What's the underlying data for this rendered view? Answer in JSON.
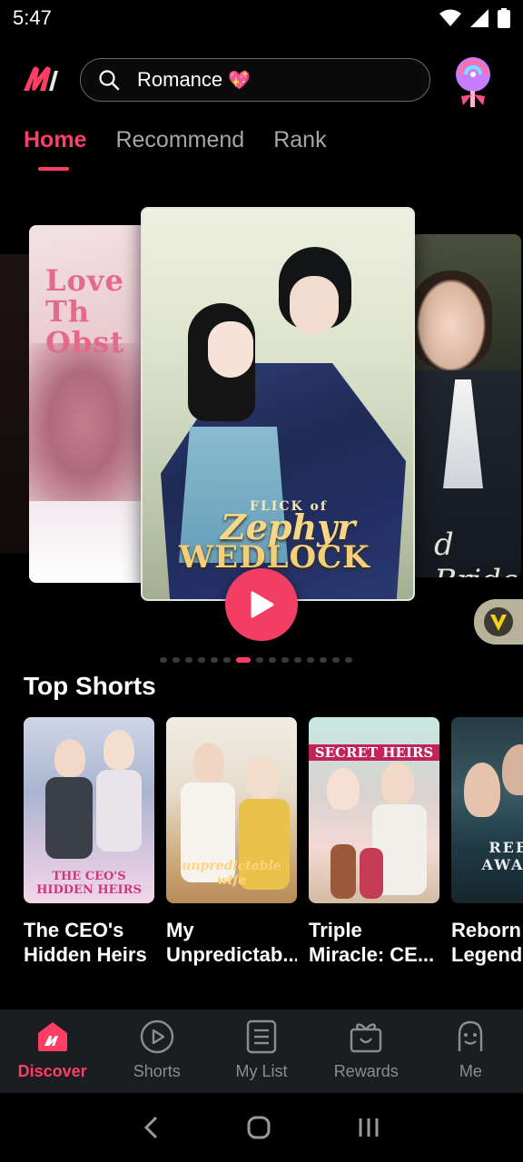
{
  "status": {
    "time": "5:47"
  },
  "search": {
    "text": "Romance",
    "emoji": "💖"
  },
  "tabs": [
    {
      "label": "Home",
      "active": true
    },
    {
      "label": "Recommend",
      "active": false
    },
    {
      "label": "Rank",
      "active": false
    }
  ],
  "carousel": {
    "left_title": "Love Th Obst",
    "main_title_small": "FLICK of",
    "main_title_1": "Zephyr",
    "main_title_2": "WEDLOCK",
    "right_title": "d Bride",
    "dots_total": 15,
    "dots_active_index": 6
  },
  "top_shorts": {
    "title": "Top Shorts",
    "items": [
      {
        "title": "The CEO's Hidden Heirs",
        "poster_text": "THE CEO'S HIDDEN HEIRS"
      },
      {
        "title": "My Unpredictab...",
        "poster_text": "unpredictable wife"
      },
      {
        "title": "Triple Miracle: CE...",
        "poster_text": "SECRET HEIRS"
      },
      {
        "title": "Reborn: Legend",
        "poster_text": "REBO AWAKE"
      }
    ]
  },
  "bottom_nav": [
    {
      "label": "Discover",
      "icon": "discover-icon",
      "active": true
    },
    {
      "label": "Shorts",
      "icon": "play-circle-icon",
      "active": false
    },
    {
      "label": "My List",
      "icon": "list-icon",
      "active": false
    },
    {
      "label": "Rewards",
      "icon": "gift-icon",
      "active": false
    },
    {
      "label": "Me",
      "icon": "profile-icon",
      "active": false
    }
  ],
  "colors": {
    "accent": "#ff3e66",
    "nav_bg": "#1b1d20"
  }
}
